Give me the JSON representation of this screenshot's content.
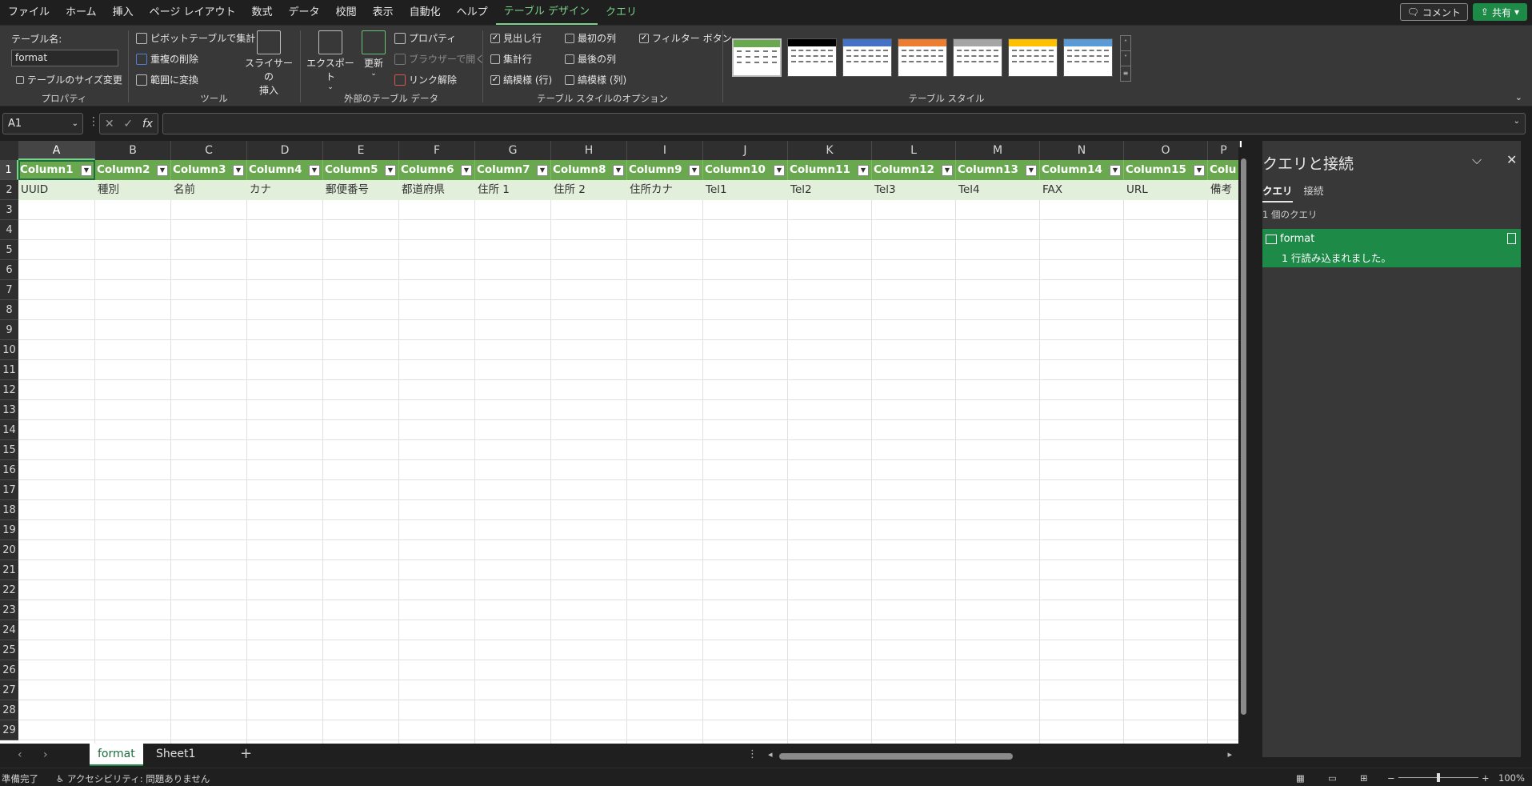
{
  "menu": {
    "items": [
      "ファイル",
      "ホーム",
      "挿入",
      "ページ レイアウト",
      "数式",
      "データ",
      "校閲",
      "表示",
      "自動化",
      "ヘルプ",
      "テーブル デザイン",
      "クエリ"
    ],
    "comment_label": "コメント",
    "share_label": "共有"
  },
  "ribbon": {
    "properties": {
      "table_name_label": "テーブル名:",
      "table_name_value": "format",
      "resize_label": "テーブルのサイズ変更",
      "group_label": "プロパティ"
    },
    "tools": {
      "pivot_label": "ピボットテーブルで集計",
      "remove_dup_label": "重複の削除",
      "convert_label": "範囲に変換",
      "slicer_line1": "スライサーの",
      "slicer_line2": "挿入",
      "group_label": "ツール"
    },
    "external": {
      "export_label": "エクスポート",
      "refresh_label": "更新",
      "properties_label": "プロパティ",
      "open_browser_label": "ブラウザーで開く",
      "unlink_label": "リンク解除",
      "group_label": "外部のテーブル データ"
    },
    "style_options": {
      "header_row": "見出し行",
      "total_row": "集計行",
      "banded_rows": "縞模様 (行)",
      "first_col": "最初の列",
      "last_col": "最後の列",
      "banded_cols": "縞模様 (列)",
      "filter_button": "フィルター ボタン",
      "group_label": "テーブル スタイルのオプション",
      "checked": {
        "header_row": true,
        "total_row": false,
        "banded_rows": true,
        "first_col": false,
        "last_col": false,
        "banded_cols": false,
        "filter_button": true
      }
    },
    "styles": {
      "group_label": "テーブル スタイル",
      "swatch_colors": [
        "#6aa84f",
        "#000000",
        "#4472c4",
        "#ed7d31",
        "#a5a5a5",
        "#ffc000",
        "#5b9bd5"
      ]
    }
  },
  "formula_bar": {
    "name_box": "A1",
    "fx_label": "fx",
    "formula": ""
  },
  "grid": {
    "columns": [
      "A",
      "B",
      "C",
      "D",
      "E",
      "F",
      "G",
      "H",
      "I",
      "J",
      "K",
      "L",
      "M",
      "N",
      "O",
      "P"
    ],
    "rows": [
      "1",
      "2",
      "3",
      "4",
      "5",
      "6",
      "7",
      "8",
      "9",
      "10",
      "11",
      "12",
      "13",
      "14",
      "15",
      "16",
      "17",
      "18",
      "19",
      "20",
      "21",
      "22",
      "23",
      "24",
      "25",
      "26",
      "27",
      "28",
      "29"
    ],
    "headers": [
      "Column1",
      "Column2",
      "Column3",
      "Column4",
      "Column5",
      "Column6",
      "Column7",
      "Column8",
      "Column9",
      "Column10",
      "Column11",
      "Column12",
      "Column13",
      "Column14",
      "Column15",
      "Colu"
    ],
    "row2": [
      "UUID",
      "種別",
      "名前",
      "カナ",
      "郵便番号",
      "都道府県",
      "住所 1",
      "住所 2",
      "住所カナ",
      "Tel1",
      "Tel2",
      "Tel3",
      "Tel4",
      "FAX",
      "URL",
      "備考"
    ],
    "accent_color": "#6aa84f"
  },
  "side_panel": {
    "title": "クエリと接続",
    "tabs": [
      "クエリ",
      "接続"
    ],
    "count": "1 個のクエリ",
    "query_name": "format",
    "query_desc": "1 行読み込まれました。"
  },
  "sheets": {
    "tabs": [
      "format",
      "Sheet1"
    ],
    "active": "format"
  },
  "status": {
    "ready": "準備完了",
    "accessibility": "アクセシビリティ: 問題ありません",
    "zoom": "100%"
  }
}
